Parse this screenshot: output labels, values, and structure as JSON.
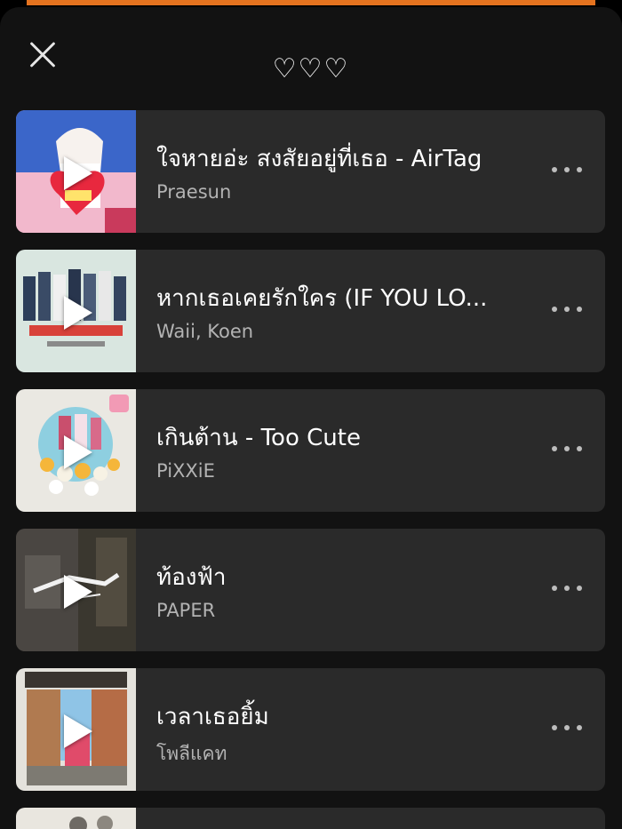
{
  "sheet": {
    "title": "♡♡♡",
    "close_icon": "close-icon"
  },
  "tracks": [
    {
      "title": "ใจหายอ่ะ สงสัยอยู่ที่เธอ - AirTag",
      "artist": "Praesun"
    },
    {
      "title": "หากเธอเคยรักใคร (IF YOU LO...",
      "artist": "Waii, Koen"
    },
    {
      "title": "เกินต้าน - Too Cute",
      "artist": "PiXXiE"
    },
    {
      "title": "ท้องฟ้า",
      "artist": "PAPER"
    },
    {
      "title": "เวลาเธอยิ้ม",
      "artist": "โพลีแคท"
    }
  ],
  "colors": {
    "accent_bar": "#e5731f",
    "sheet_bg": "#121212",
    "row_bg": "#2a2a2a",
    "secondary_text": "#b3b3b3"
  }
}
